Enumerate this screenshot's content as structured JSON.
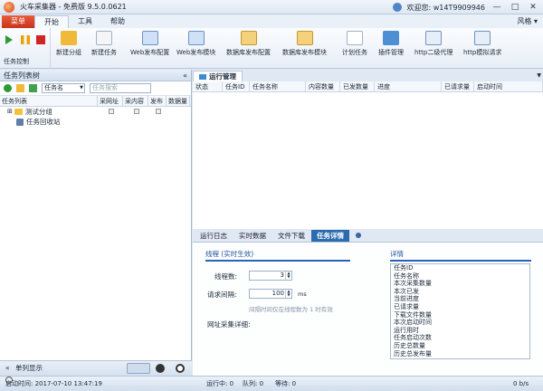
{
  "window": {
    "title": "火车采集器 - 免费版 9.5.0.0621",
    "welcome": "欢迎您: w14T9909946",
    "controls": [
      "—",
      "□",
      "✕"
    ]
  },
  "menu": {
    "tabs": [
      "菜单",
      "开始",
      "工具",
      "帮助"
    ],
    "style_label": "风格 ▾"
  },
  "ribbon": {
    "task_control_label": "任务控制",
    "buttons": [
      "新建分组",
      "新建任务",
      "Web发布配置",
      "Web发布模块",
      "数据库发布配置",
      "数据库发布模块",
      "计划任务",
      "插件管理",
      "http二级代理",
      "http模拟请求"
    ]
  },
  "left_panel": {
    "title": "任务列表树",
    "collapse": "«",
    "search_field": "任务名",
    "search_placeholder": "任务搜索",
    "columns": [
      "任务列表",
      "采网址",
      "采内容",
      "发布",
      "数据量"
    ],
    "rows": [
      "测试分组",
      "任务回收站"
    ],
    "expand": "⊞",
    "footer_label": "单列显示",
    "footer_icon": "«"
  },
  "main": {
    "tab": "运行管理",
    "columns": [
      "状态",
      "任务ID",
      "任务名称",
      "内容数量",
      "已发数量",
      "进度",
      "已请求量",
      "启动时间"
    ]
  },
  "detail": {
    "tabs": [
      "运行日志",
      "实时数据",
      "文件下载",
      "任务详情"
    ],
    "thread_section": "线程 (实时生效)",
    "detail_section": "详情",
    "thread_count_label": "线程数:",
    "thread_count": "3",
    "interval_label": "请求间隔:",
    "interval_value": "100",
    "interval_unit": "ms",
    "hint": "间隔时间仅在线程数为 1 时有效",
    "url_detail_label": "网址采集详细:",
    "detail_items": [
      "任务ID",
      "任务名称",
      "本次采集数量",
      "本次已发",
      "当前进度",
      "已请求量",
      "下载文件数量",
      "本次启动时间",
      "运行用时",
      "任务启动次数",
      "历史总数量",
      "历史总发布量"
    ]
  },
  "status": {
    "start_time": "启动时间: 2017-07-10 13:47:19",
    "running": "运行中: 0",
    "queued": "队列: 0",
    "waiting": "等待: 0",
    "speed": "0 b/s"
  }
}
